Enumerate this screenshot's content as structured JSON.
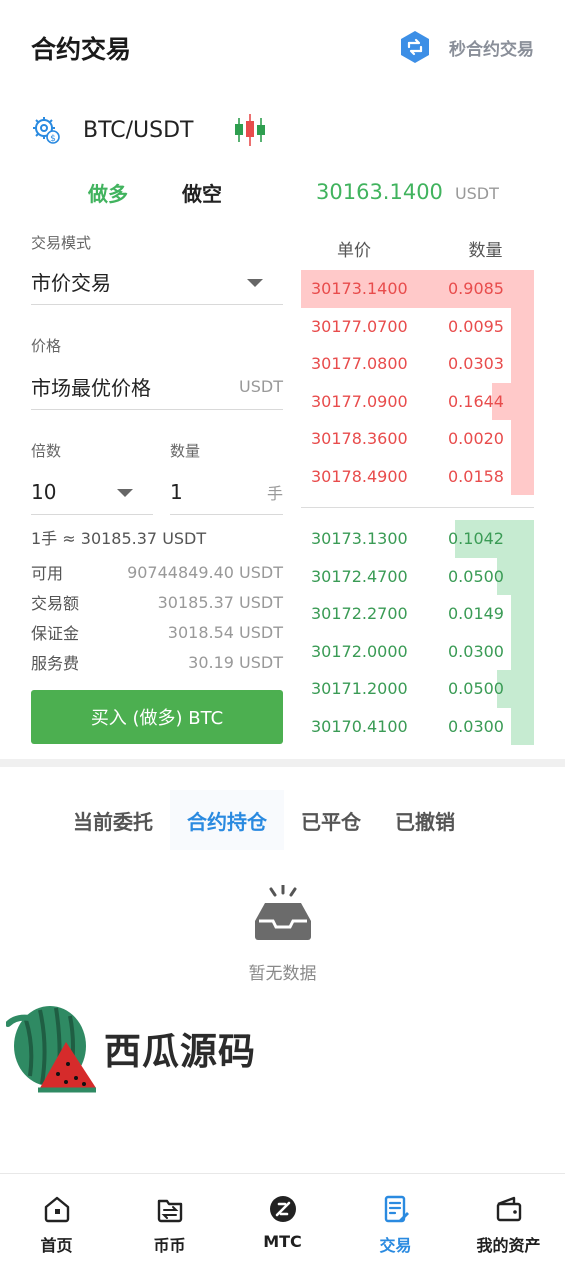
{
  "header": {
    "title": "合约交易",
    "second_contract_label": "秒合约交易"
  },
  "pair": {
    "symbol": "BTC/USDT"
  },
  "direction": {
    "long_label": "做多",
    "short_label": "做空"
  },
  "last_price": {
    "value": "30163.1400",
    "unit": "USDT"
  },
  "form": {
    "mode_label": "交易模式",
    "mode_value": "市价交易",
    "price_label": "价格",
    "price_value": "市场最优价格",
    "price_unit": "USDT",
    "leverage_label": "倍数",
    "leverage_value": "10",
    "quantity_label": "数量",
    "quantity_value": "1",
    "quantity_unit": "手",
    "lot_note": "1手 ≈ 30185.37 USDT",
    "info": [
      {
        "key": "可用",
        "value": "90744849.40 USDT"
      },
      {
        "key": "交易额",
        "value": "30185.37 USDT"
      },
      {
        "key": "保证金",
        "value": "3018.54 USDT"
      },
      {
        "key": "服务费",
        "value": "30.19 USDT"
      }
    ],
    "buy_button": "买入 (做多) BTC"
  },
  "orderbook": {
    "price_header": "单价",
    "qty_header": "数量",
    "asks": [
      {
        "price": "30173.1400",
        "qty": "0.9085",
        "depth": 1.0
      },
      {
        "price": "30177.0700",
        "qty": "0.0095",
        "depth": 0.1
      },
      {
        "price": "30177.0800",
        "qty": "0.0303",
        "depth": 0.1
      },
      {
        "price": "30177.0900",
        "qty": "0.1644",
        "depth": 0.18
      },
      {
        "price": "30178.3600",
        "qty": "0.0020",
        "depth": 0.1
      },
      {
        "price": "30178.4900",
        "qty": "0.0158",
        "depth": 0.1
      }
    ],
    "bids": [
      {
        "price": "30173.1300",
        "qty": "0.1042",
        "depth": 0.34
      },
      {
        "price": "30172.4700",
        "qty": "0.0500",
        "depth": 0.16
      },
      {
        "price": "30172.2700",
        "qty": "0.0149",
        "depth": 0.1
      },
      {
        "price": "30172.0000",
        "qty": "0.0300",
        "depth": 0.1
      },
      {
        "price": "30171.2000",
        "qty": "0.0500",
        "depth": 0.16
      },
      {
        "price": "30170.4100",
        "qty": "0.0300",
        "depth": 0.1
      }
    ]
  },
  "order_tabs": [
    {
      "label": "当前委托"
    },
    {
      "label": "合约持仓",
      "active": true
    },
    {
      "label": "已平仓"
    },
    {
      "label": "已撤销"
    }
  ],
  "empty": {
    "text": "暂无数据"
  },
  "watermark": {
    "text": "西瓜源码"
  },
  "tabbar": [
    {
      "label": "首页",
      "icon": "home-icon"
    },
    {
      "label": "币币",
      "icon": "exchange-icon"
    },
    {
      "label": "MTC",
      "icon": "mtc-icon"
    },
    {
      "label": "交易",
      "icon": "trade-icon",
      "active": true
    },
    {
      "label": "我的资产",
      "icon": "wallet-icon"
    }
  ],
  "colors": {
    "green": "#41b35e",
    "red": "#e84c4c",
    "blue": "#2a8ae0"
  }
}
